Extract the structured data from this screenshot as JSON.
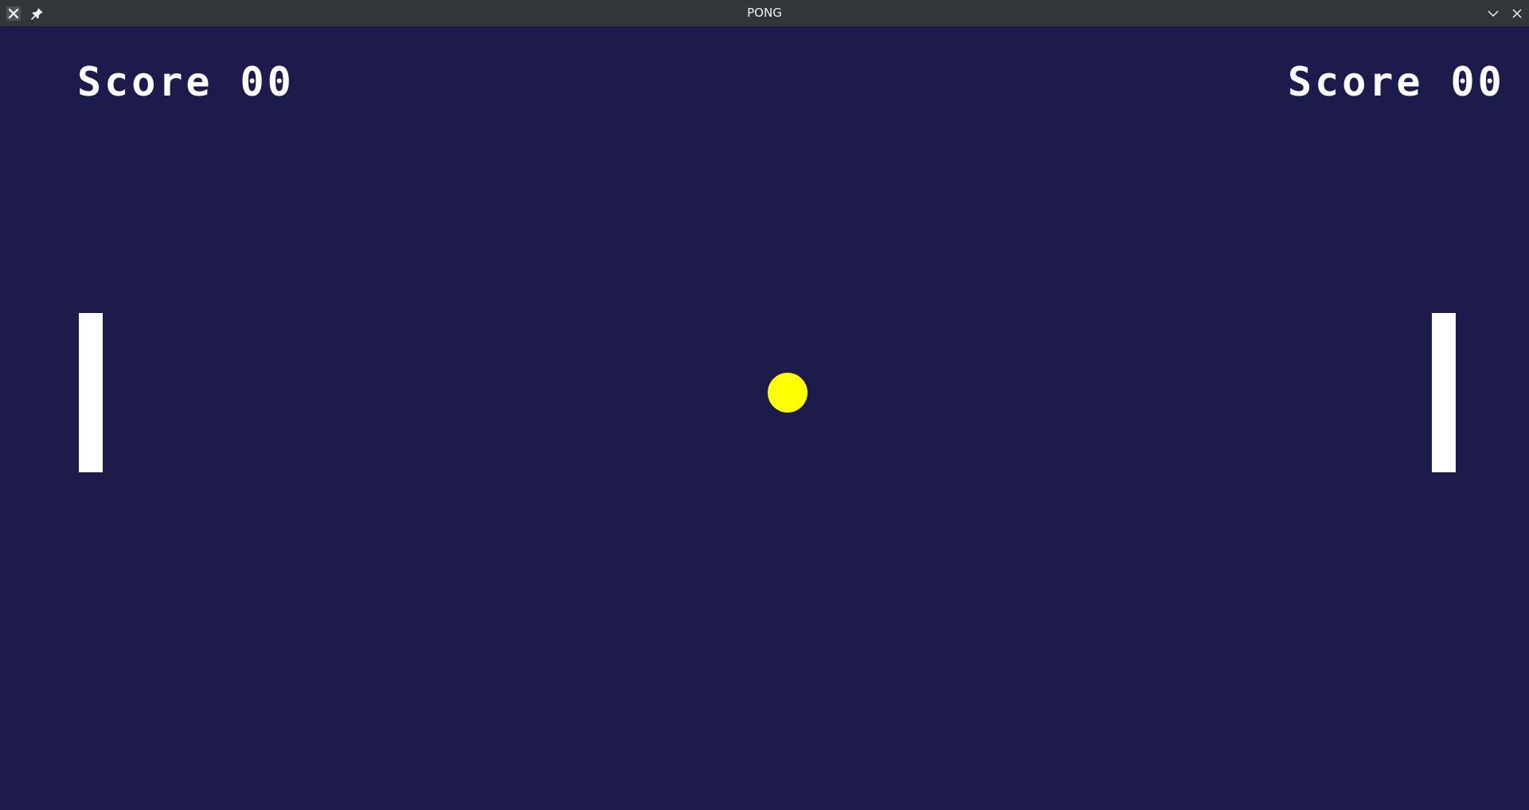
{
  "window": {
    "title": "PONG",
    "icons": {
      "app": "close-x-icon",
      "pin": "pin-icon",
      "minimize": "chevron-down-icon",
      "close": "close-icon"
    }
  },
  "game": {
    "left_score": {
      "label": "Score",
      "value": "00"
    },
    "right_score": {
      "label": "Score",
      "value": "00"
    }
  },
  "colors": {
    "background": "#1c1b4b",
    "titlebar": "#31363b",
    "paddle": "#ffffff",
    "ball": "#ffff00",
    "score_text": "#ffffff"
  }
}
